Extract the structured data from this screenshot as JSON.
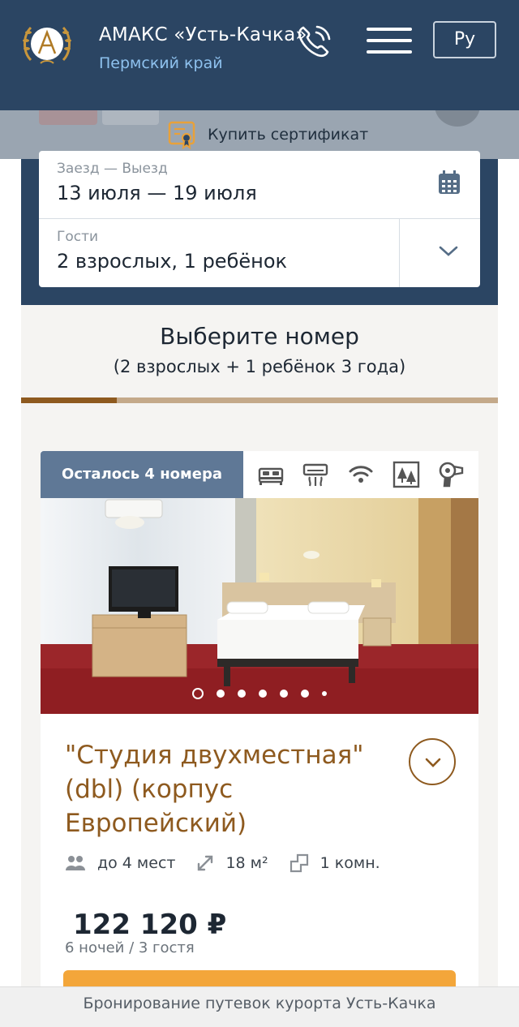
{
  "header": {
    "brand_title": "АМАКС «Усть-Качка»",
    "brand_subtitle": "Пермский край",
    "language_label": "Ру",
    "colors": {
      "navy": "#2b4563",
      "subtitle": "#8ec1ee",
      "logo_gold": "#c8963c"
    }
  },
  "certificate": {
    "label": "Купить сертификат"
  },
  "search": {
    "dates_label": "Заезд — Выезд",
    "dates_value": "13 июля — 19 июля",
    "guests_label": "Гости",
    "guests_value": "2 взрослых, 1 ребёнок"
  },
  "section": {
    "title": "Выберите номер",
    "subtitle": "(2 взрослых + 1 ребёнок 3 года)",
    "progress": 0.2
  },
  "room": {
    "badge": "Осталось 4 номера",
    "amenities": [
      "bed-icon",
      "air-conditioner-icon",
      "wifi-icon",
      "forest-view-icon",
      "hair-dryer-icon"
    ],
    "photo_count": 7,
    "active_photo": 1,
    "title": "\"Студия двухместная\" (dbl) (корпус Европейский)",
    "capacity": "до 4 мест",
    "area": "18 м²",
    "rooms": "1 комн.",
    "price": "122 120 ₽",
    "price_note": "6 ночей / 3 гостя",
    "accent_color": "#8e5a1f",
    "button_color": "#f3a63a"
  },
  "footer": {
    "text": "Бронирование путевок курорта Усть-Качка"
  }
}
